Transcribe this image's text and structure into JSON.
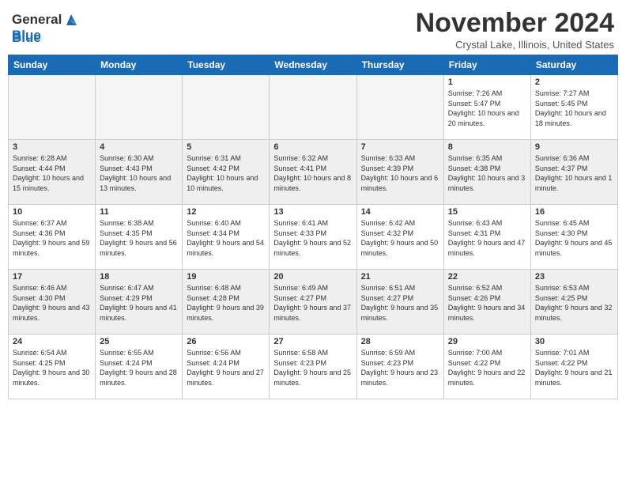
{
  "header": {
    "logo_general": "General",
    "logo_blue": "Blue",
    "month_title": "November 2024",
    "location": "Crystal Lake, Illinois, United States"
  },
  "weekdays": [
    "Sunday",
    "Monday",
    "Tuesday",
    "Wednesday",
    "Thursday",
    "Friday",
    "Saturday"
  ],
  "weeks": [
    [
      {
        "day": "",
        "sunrise": "",
        "sunset": "",
        "daylight": "",
        "empty": true
      },
      {
        "day": "",
        "sunrise": "",
        "sunset": "",
        "daylight": "",
        "empty": true
      },
      {
        "day": "",
        "sunrise": "",
        "sunset": "",
        "daylight": "",
        "empty": true
      },
      {
        "day": "",
        "sunrise": "",
        "sunset": "",
        "daylight": "",
        "empty": true
      },
      {
        "day": "",
        "sunrise": "",
        "sunset": "",
        "daylight": "",
        "empty": true
      },
      {
        "day": "1",
        "sunrise": "Sunrise: 7:26 AM",
        "sunset": "Sunset: 5:47 PM",
        "daylight": "Daylight: 10 hours and 20 minutes."
      },
      {
        "day": "2",
        "sunrise": "Sunrise: 7:27 AM",
        "sunset": "Sunset: 5:45 PM",
        "daylight": "Daylight: 10 hours and 18 minutes."
      }
    ],
    [
      {
        "day": "3",
        "sunrise": "Sunrise: 6:28 AM",
        "sunset": "Sunset: 4:44 PM",
        "daylight": "Daylight: 10 hours and 15 minutes."
      },
      {
        "day": "4",
        "sunrise": "Sunrise: 6:30 AM",
        "sunset": "Sunset: 4:43 PM",
        "daylight": "Daylight: 10 hours and 13 minutes."
      },
      {
        "day": "5",
        "sunrise": "Sunrise: 6:31 AM",
        "sunset": "Sunset: 4:42 PM",
        "daylight": "Daylight: 10 hours and 10 minutes."
      },
      {
        "day": "6",
        "sunrise": "Sunrise: 6:32 AM",
        "sunset": "Sunset: 4:41 PM",
        "daylight": "Daylight: 10 hours and 8 minutes."
      },
      {
        "day": "7",
        "sunrise": "Sunrise: 6:33 AM",
        "sunset": "Sunset: 4:39 PM",
        "daylight": "Daylight: 10 hours and 6 minutes."
      },
      {
        "day": "8",
        "sunrise": "Sunrise: 6:35 AM",
        "sunset": "Sunset: 4:38 PM",
        "daylight": "Daylight: 10 hours and 3 minutes."
      },
      {
        "day": "9",
        "sunrise": "Sunrise: 6:36 AM",
        "sunset": "Sunset: 4:37 PM",
        "daylight": "Daylight: 10 hours and 1 minute."
      }
    ],
    [
      {
        "day": "10",
        "sunrise": "Sunrise: 6:37 AM",
        "sunset": "Sunset: 4:36 PM",
        "daylight": "Daylight: 9 hours and 59 minutes."
      },
      {
        "day": "11",
        "sunrise": "Sunrise: 6:38 AM",
        "sunset": "Sunset: 4:35 PM",
        "daylight": "Daylight: 9 hours and 56 minutes."
      },
      {
        "day": "12",
        "sunrise": "Sunrise: 6:40 AM",
        "sunset": "Sunset: 4:34 PM",
        "daylight": "Daylight: 9 hours and 54 minutes."
      },
      {
        "day": "13",
        "sunrise": "Sunrise: 6:41 AM",
        "sunset": "Sunset: 4:33 PM",
        "daylight": "Daylight: 9 hours and 52 minutes."
      },
      {
        "day": "14",
        "sunrise": "Sunrise: 6:42 AM",
        "sunset": "Sunset: 4:32 PM",
        "daylight": "Daylight: 9 hours and 50 minutes."
      },
      {
        "day": "15",
        "sunrise": "Sunrise: 6:43 AM",
        "sunset": "Sunset: 4:31 PM",
        "daylight": "Daylight: 9 hours and 47 minutes."
      },
      {
        "day": "16",
        "sunrise": "Sunrise: 6:45 AM",
        "sunset": "Sunset: 4:30 PM",
        "daylight": "Daylight: 9 hours and 45 minutes."
      }
    ],
    [
      {
        "day": "17",
        "sunrise": "Sunrise: 6:46 AM",
        "sunset": "Sunset: 4:30 PM",
        "daylight": "Daylight: 9 hours and 43 minutes."
      },
      {
        "day": "18",
        "sunrise": "Sunrise: 6:47 AM",
        "sunset": "Sunset: 4:29 PM",
        "daylight": "Daylight: 9 hours and 41 minutes."
      },
      {
        "day": "19",
        "sunrise": "Sunrise: 6:48 AM",
        "sunset": "Sunset: 4:28 PM",
        "daylight": "Daylight: 9 hours and 39 minutes."
      },
      {
        "day": "20",
        "sunrise": "Sunrise: 6:49 AM",
        "sunset": "Sunset: 4:27 PM",
        "daylight": "Daylight: 9 hours and 37 minutes."
      },
      {
        "day": "21",
        "sunrise": "Sunrise: 6:51 AM",
        "sunset": "Sunset: 4:27 PM",
        "daylight": "Daylight: 9 hours and 35 minutes."
      },
      {
        "day": "22",
        "sunrise": "Sunrise: 6:52 AM",
        "sunset": "Sunset: 4:26 PM",
        "daylight": "Daylight: 9 hours and 34 minutes."
      },
      {
        "day": "23",
        "sunrise": "Sunrise: 6:53 AM",
        "sunset": "Sunset: 4:25 PM",
        "daylight": "Daylight: 9 hours and 32 minutes."
      }
    ],
    [
      {
        "day": "24",
        "sunrise": "Sunrise: 6:54 AM",
        "sunset": "Sunset: 4:25 PM",
        "daylight": "Daylight: 9 hours and 30 minutes."
      },
      {
        "day": "25",
        "sunrise": "Sunrise: 6:55 AM",
        "sunset": "Sunset: 4:24 PM",
        "daylight": "Daylight: 9 hours and 28 minutes."
      },
      {
        "day": "26",
        "sunrise": "Sunrise: 6:56 AM",
        "sunset": "Sunset: 4:24 PM",
        "daylight": "Daylight: 9 hours and 27 minutes."
      },
      {
        "day": "27",
        "sunrise": "Sunrise: 6:58 AM",
        "sunset": "Sunset: 4:23 PM",
        "daylight": "Daylight: 9 hours and 25 minutes."
      },
      {
        "day": "28",
        "sunrise": "Sunrise: 6:59 AM",
        "sunset": "Sunset: 4:23 PM",
        "daylight": "Daylight: 9 hours and 23 minutes."
      },
      {
        "day": "29",
        "sunrise": "Sunrise: 7:00 AM",
        "sunset": "Sunset: 4:22 PM",
        "daylight": "Daylight: 9 hours and 22 minutes."
      },
      {
        "day": "30",
        "sunrise": "Sunrise: 7:01 AM",
        "sunset": "Sunset: 4:22 PM",
        "daylight": "Daylight: 9 hours and 21 minutes."
      }
    ]
  ]
}
